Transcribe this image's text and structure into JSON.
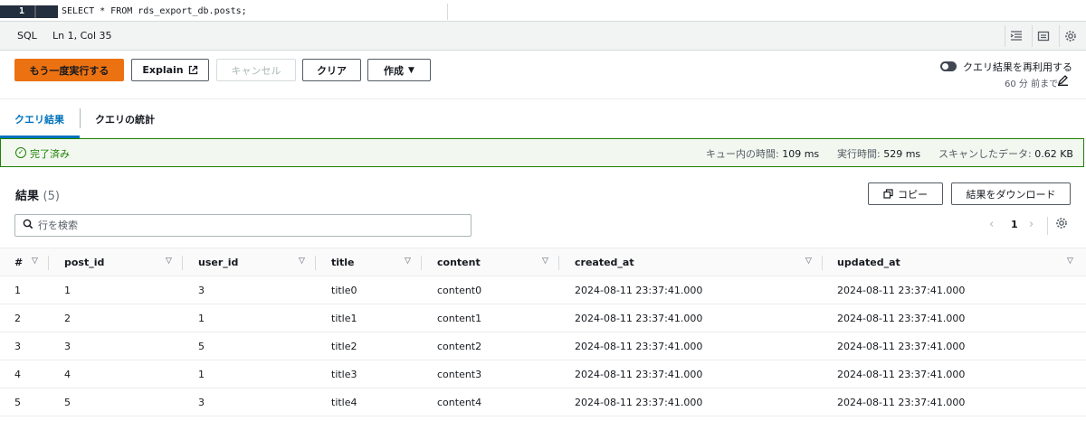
{
  "editor": {
    "line_number": "1",
    "code": "SELECT * FROM rds_export_db.posts;"
  },
  "statusbar": {
    "language": "SQL",
    "cursor": "Ln 1, Col 35"
  },
  "toolbar": {
    "rerun_label": "もう一度実行する",
    "explain_label": "Explain",
    "cancel_label": "キャンセル",
    "clear_label": "クリア",
    "create_label": "作成",
    "reuse_label": "クエリ結果を再利用する",
    "reuse_age": "60 分 前まで"
  },
  "tabs": [
    {
      "label": "クエリ結果",
      "active": true
    },
    {
      "label": "クエリの統計",
      "active": false
    }
  ],
  "banner": {
    "status": "完了済み",
    "queue_label": "キュー内の時間:",
    "queue_value": "109 ms",
    "exec_label": "実行時間:",
    "exec_value": "529 ms",
    "scan_label": "スキャンしたデータ:",
    "scan_value": "0.62 KB"
  },
  "results": {
    "title": "結果",
    "count": "(5)",
    "copy_label": "コピー",
    "download_label": "結果をダウンロード",
    "search_placeholder": "行を検索",
    "page": "1"
  },
  "table": {
    "columns": [
      "#",
      "post_id",
      "user_id",
      "title",
      "content",
      "created_at",
      "updated_at"
    ],
    "rows": [
      [
        "1",
        "1",
        "3",
        "title0",
        "content0",
        "2024-08-11 23:37:41.000",
        "2024-08-11 23:37:41.000"
      ],
      [
        "2",
        "2",
        "1",
        "title1",
        "content1",
        "2024-08-11 23:37:41.000",
        "2024-08-11 23:37:41.000"
      ],
      [
        "3",
        "3",
        "5",
        "title2",
        "content2",
        "2024-08-11 23:37:41.000",
        "2024-08-11 23:37:41.000"
      ],
      [
        "4",
        "4",
        "1",
        "title3",
        "content3",
        "2024-08-11 23:37:41.000",
        "2024-08-11 23:37:41.000"
      ],
      [
        "5",
        "5",
        "3",
        "title4",
        "content4",
        "2024-08-11 23:37:41.000",
        "2024-08-11 23:37:41.000"
      ]
    ]
  },
  "colors": {
    "primary_button": "#ec7211",
    "tab_active": "#0073bb",
    "success": "#1d8102"
  }
}
